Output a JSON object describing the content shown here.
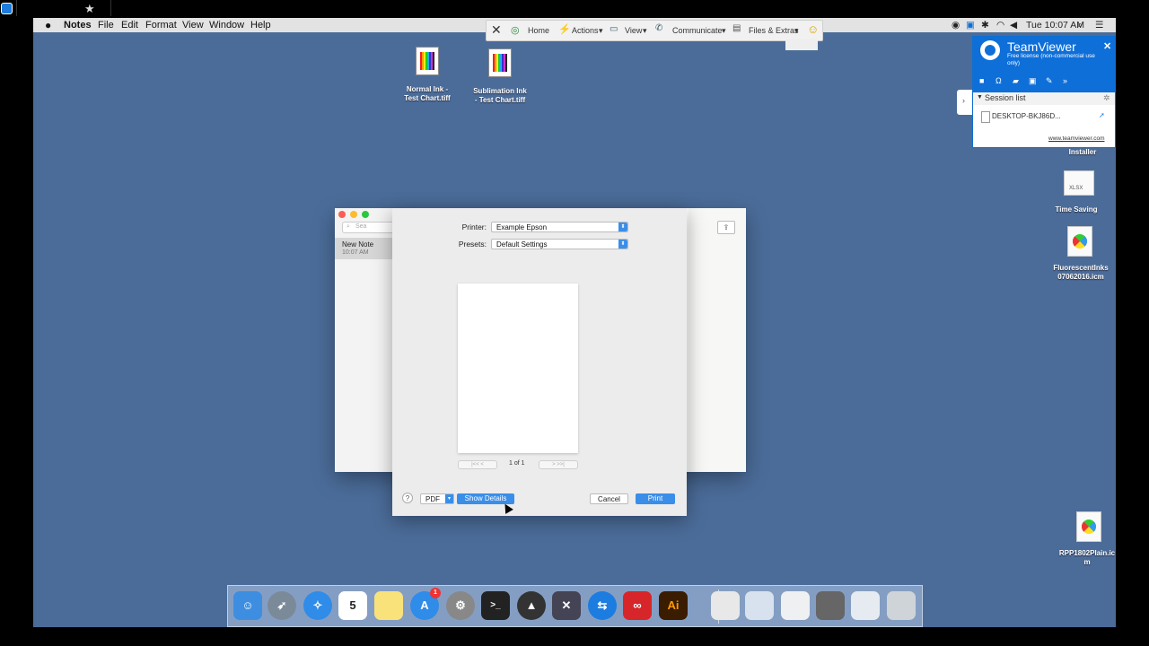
{
  "host": {
    "star_icon": "★"
  },
  "menubar": {
    "app_name": "Notes",
    "menus": [
      "File",
      "Edit",
      "Format",
      "View",
      "Window",
      "Help"
    ],
    "clock": "Tue 10:07 AM"
  },
  "tv_toolbar": {
    "close": "✕",
    "home": "Home",
    "actions": "Actions",
    "view": "View",
    "communicate": "Communicate",
    "files": "Files & Extras",
    "dropdown_arrow": "▾",
    "smiley": "☺"
  },
  "desktop_icons": [
    {
      "label_line1": "Normal Ink -",
      "label_line2": "Test Chart.tiff"
    },
    {
      "label_line1": "Sublimation Ink",
      "label_line2": "- Test Chart.tiff"
    },
    {
      "label_line1": "Installer",
      "label_line2": ""
    },
    {
      "label_line1": "Time Saving",
      "label_line2": "",
      "badge": "XLSX"
    },
    {
      "label_line1": "FluorescentInks",
      "label_line2": "07062016.icm"
    },
    {
      "label_line1": "RPP1802Plain.ic",
      "label_line2": "m"
    }
  ],
  "teamviewer": {
    "title": "TeamViewer",
    "subtitle": "Free license (non-commercial use only)",
    "close": "✕",
    "session_list": "Session list",
    "device": "DESKTOP-BKJ86D...",
    "link": "www.teamviewer.com",
    "side_arrow": "›"
  },
  "notes": {
    "search_placeholder": "Sea",
    "note_title": "New Note",
    "note_time": "10:07 AM",
    "share_glyph": "⇪"
  },
  "print": {
    "printer_label": "Printer:",
    "printer_value": "Example Epson",
    "presets_label": "Presets:",
    "presets_value": "Default Settings",
    "select_arrow": "⬍",
    "page_count": "1 of 1",
    "prev_glyph": "|<<   <",
    "next_glyph": ">   >>|",
    "help": "?",
    "pdf": "PDF",
    "pdf_arrow": "▾",
    "show_details": "Show Details",
    "cancel": "Cancel",
    "print": "Print"
  },
  "dock": {
    "calendar_day": "5",
    "appstore_badge": "1",
    "illustrator": "Ai",
    "terminal": ">_"
  },
  "colors": {
    "desktop": "#4b6c99",
    "accent": "#3a8ee8",
    "teamviewer": "#0e6fd9"
  }
}
